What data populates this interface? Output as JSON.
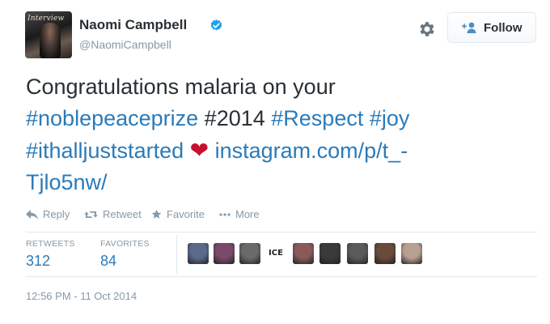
{
  "user": {
    "display_name": "Naomi Campbell",
    "handle": "@NaomiCampbell",
    "avatar_text": "Interview",
    "verified": true
  },
  "header": {
    "follow_label": "Follow",
    "settings_icon": "gear-icon",
    "follow_icon": "add-user-icon"
  },
  "tweet": {
    "text_line1": "Congratulations malaria on your",
    "hashtag_noblepeaceprize": "#noblepeaceprize",
    "text_2014": " #2014 ",
    "hashtag_respect": "#Respect",
    "hashtag_joy": "#joy",
    "hashtag_ithalljuststarted": "#ithalljuststarted",
    "heart": "❤",
    "link_part1": "instagram.com/p/t_-",
    "link_part2": "Tjlo5nw/"
  },
  "actions": {
    "reply": "Reply",
    "retweet": "Retweet",
    "favorite": "Favorite",
    "more": "More"
  },
  "stats": {
    "retweets_label": "RETWEETS",
    "retweets_value": "312",
    "favorites_label": "FAVORITES",
    "favorites_value": "84"
  },
  "favoriters": {
    "ice_text": "ICE",
    "colors": [
      "#5a6a8a",
      "#7a4a6a",
      "#6a6a6a",
      "#ffffff",
      "#8a5a5a",
      "#3a3a3a",
      "#5a5a5a",
      "#6a4a3a",
      "#b8a090",
      "#a07060"
    ]
  },
  "timestamp": "12:56 PM - 11 Oct 2014",
  "colors": {
    "link": "#2b7bb9",
    "muted": "#8899a6",
    "text": "#292f33",
    "verified": "#1da1f2",
    "heart": "#c8102e"
  }
}
